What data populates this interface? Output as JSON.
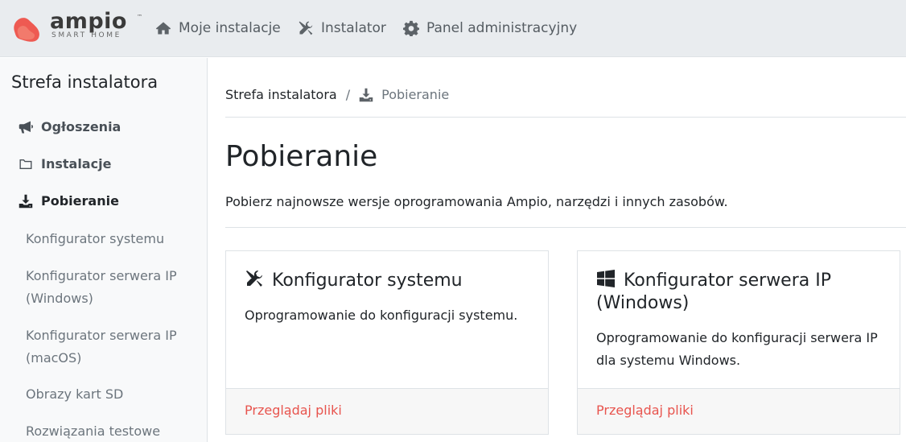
{
  "brand": {
    "name": "ampio",
    "tagline": "SMART HOME",
    "mark_color": "#ee5a52"
  },
  "topnav": {
    "items": [
      {
        "label": "Moje instalacje",
        "icon": "home-icon"
      },
      {
        "label": "Instalator",
        "icon": "tools-icon"
      },
      {
        "label": "Panel administracyjny",
        "icon": "gear-icon"
      }
    ]
  },
  "sidebar": {
    "title": "Strefa instalatora",
    "items": [
      {
        "label": "Ogłoszenia",
        "icon": "megaphone-icon"
      },
      {
        "label": "Instalacje",
        "icon": "folder-icon"
      },
      {
        "label": "Pobieranie",
        "icon": "download-icon",
        "active": true
      }
    ],
    "subitems": [
      "Konfigurator systemu",
      "Konfigurator serwera IP (Windows)",
      "Konfigurator serwera IP (macOS)",
      "Obrazy kart SD",
      "Rozwiązania testowe"
    ]
  },
  "breadcrumb": {
    "parent": "Strefa instalatora",
    "separator": "/",
    "current": "Pobieranie"
  },
  "main": {
    "title": "Pobieranie",
    "description": "Pobierz najnowsze wersje oprogramowania Ampio, narzędzi i innych zasobów.",
    "cards": [
      {
        "icon": "tools-icon",
        "title": "Konfigurator systemu",
        "text": "Oprogramowanie do konfiguracji systemu.",
        "link": "Przeglądaj pliki"
      },
      {
        "icon": "windows-icon",
        "title": "Konfigurator serwera IP (Windows)",
        "text": "Oprogramowanie do konfiguracji serwera IP dla systemu Windows.",
        "link": "Przeglądaj pliki"
      }
    ]
  },
  "colors": {
    "accent": "#e8544e",
    "navbar_bg": "#e9ecef",
    "sidebar_bg": "#f8f9fa"
  }
}
